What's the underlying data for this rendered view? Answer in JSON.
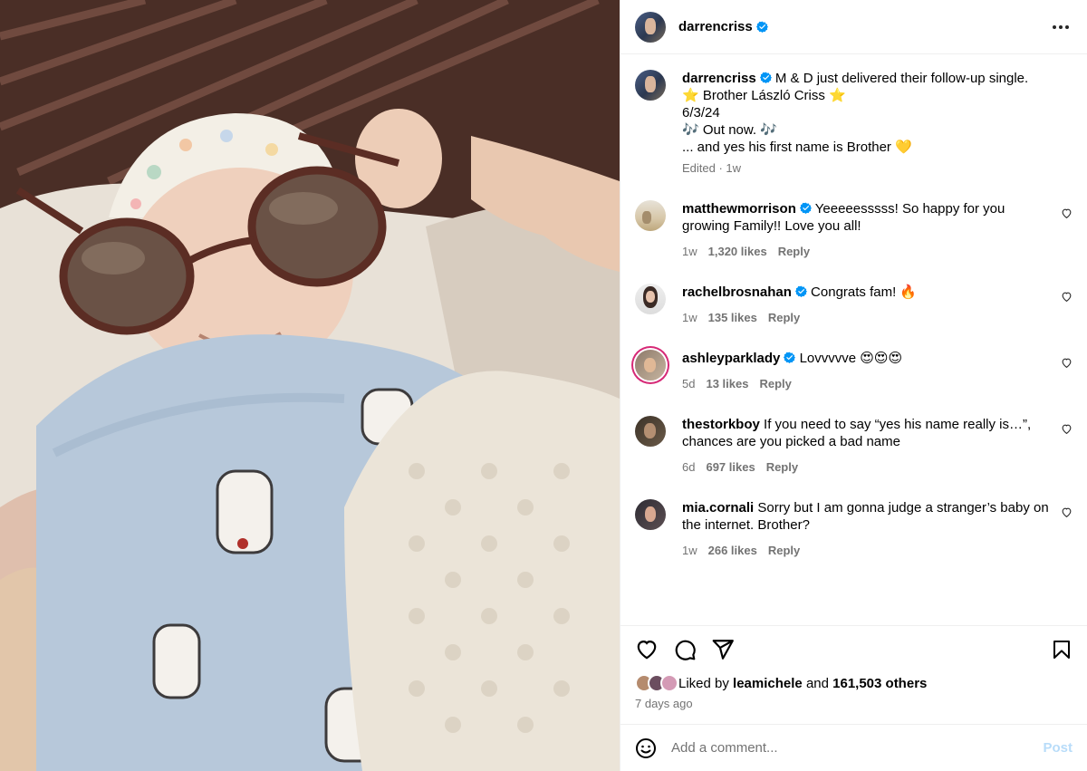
{
  "post": {
    "author": "darrencriss",
    "caption": {
      "first_line": "M & D just delivered their follow-up single.",
      "lines": [
        "⭐️ Brother László Criss ⭐️",
        "6/3/24",
        "🎶 Out now. 🎶",
        "... and yes his first name is Brother 💛"
      ],
      "meta": "Edited · 1w"
    },
    "comments": [
      {
        "user": "matthewmorrison",
        "verified": true,
        "text": "Yeeeeesssss! So happy for you growing Family!! Love you all!",
        "time": "1w",
        "likes": "1,320 likes",
        "reply": "Reply"
      },
      {
        "user": "rachelbrosnahan",
        "verified": true,
        "text": "Congrats fam! 🔥",
        "time": "1w",
        "likes": "135 likes",
        "reply": "Reply"
      },
      {
        "user": "ashleyparklady",
        "verified": true,
        "text": "Lovvvvve 😍😍😍",
        "time": "5d",
        "likes": "13 likes",
        "reply": "Reply"
      },
      {
        "user": "thestorkboy",
        "verified": false,
        "text": "If you need to say “yes his name really is…”, chances are you picked a bad name",
        "time": "6d",
        "likes": "697 likes",
        "reply": "Reply"
      },
      {
        "user": "mia.cornali",
        "verified": false,
        "text": "Sorry but I am gonna judge a stranger’s baby on the internet. Brother?",
        "time": "1w",
        "likes": "266 likes",
        "reply": "Reply"
      }
    ],
    "liked_by_prefix": "Liked by",
    "liked_by_user": "leamichele",
    "liked_by_and": "and",
    "liked_by_others": "161,503 others",
    "date": "7 days ago",
    "comment_input": {
      "placeholder": "Add a comment..."
    },
    "post_button": "Post"
  },
  "icons": {
    "verified": "verified-badge-icon",
    "more": "more-options-icon",
    "like": "heart-icon",
    "comment": "comment-icon",
    "share": "share-icon",
    "save": "bookmark-icon",
    "emoji": "emoji-icon"
  },
  "colors": {
    "verified": "#0095f6",
    "secondary_text": "#737373",
    "post_button_disabled": "#b8dcf9",
    "divider": "#efefef"
  }
}
